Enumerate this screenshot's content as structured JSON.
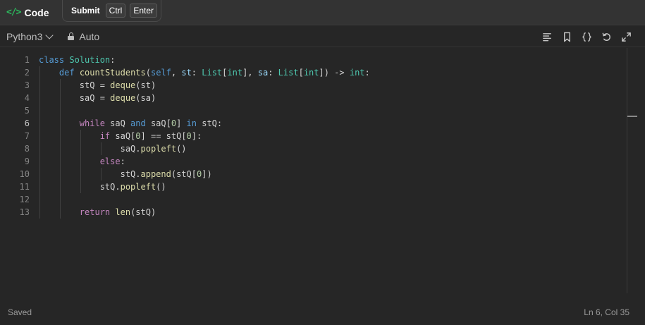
{
  "header": {
    "title": "Code",
    "icon": "code-brackets-icon",
    "submit_label": "Submit",
    "shortcut_keys": [
      "Ctrl",
      "Enter"
    ]
  },
  "toolbar": {
    "language": "Python3",
    "mode": "Auto",
    "tools": [
      "format-icon",
      "bookmark-icon",
      "braces-icon",
      "reset-icon",
      "fullscreen-icon"
    ]
  },
  "editor": {
    "line_numbers": [
      "1",
      "2",
      "3",
      "4",
      "5",
      "6",
      "7",
      "8",
      "9",
      "10",
      "11",
      "12",
      "13"
    ],
    "active_line": 6,
    "lines": [
      "class Solution:",
      "    def countStudents(self, st: List[int], sa: List[int]) -> int:",
      "        stQ = deque(st)",
      "        saQ = deque(sa)",
      "",
      "        while saQ and saQ[0] in stQ:",
      "            if saQ[0] == stQ[0]:",
      "                saQ.popleft()",
      "            else:",
      "                stQ.append(stQ[0])",
      "            stQ.popleft()",
      "",
      "        return len(stQ)"
    ]
  },
  "status": {
    "saved": "Saved",
    "cursor": "Ln 6, Col 35"
  },
  "colors": {
    "accent": "#2cbb5d",
    "keyword": "#569cd6",
    "control": "#c586c0",
    "function": "#dcdcaa",
    "type": "#4ec9b0",
    "number": "#b5cea8"
  }
}
